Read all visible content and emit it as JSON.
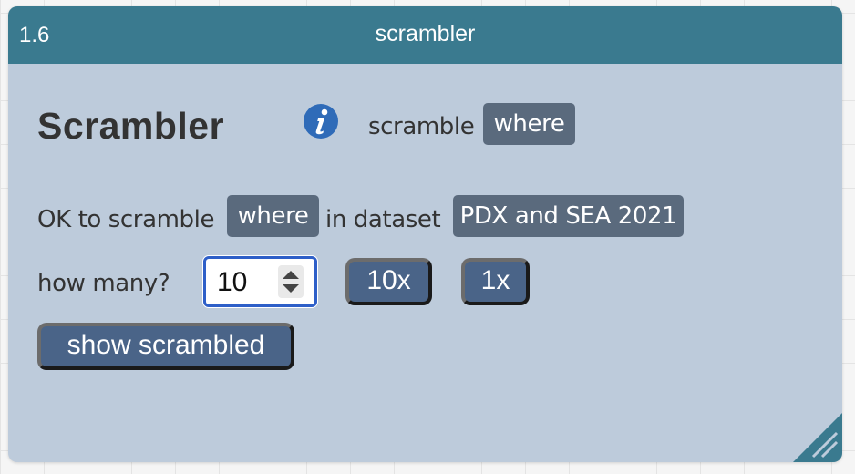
{
  "window": {
    "number": "1.6",
    "title": "scrambler"
  },
  "heading": "Scrambler",
  "header_row": {
    "prefix": "scramble",
    "attribute_chip": "where"
  },
  "ok_row": {
    "prefix": "OK to scramble",
    "attribute_chip": "where",
    "middle": "in dataset",
    "dataset_chip": "PDX and SEA 2021"
  },
  "how_many": {
    "label": "how many?",
    "value": "10"
  },
  "buttons": {
    "ten_x": "10x",
    "one_x": "1x",
    "show_scrambled": "show scrambled"
  },
  "colors": {
    "titlebar": "#3a7a8f",
    "panel": "#bdcbdb",
    "chip": "#5a6a7d",
    "button": "#4a6488"
  }
}
